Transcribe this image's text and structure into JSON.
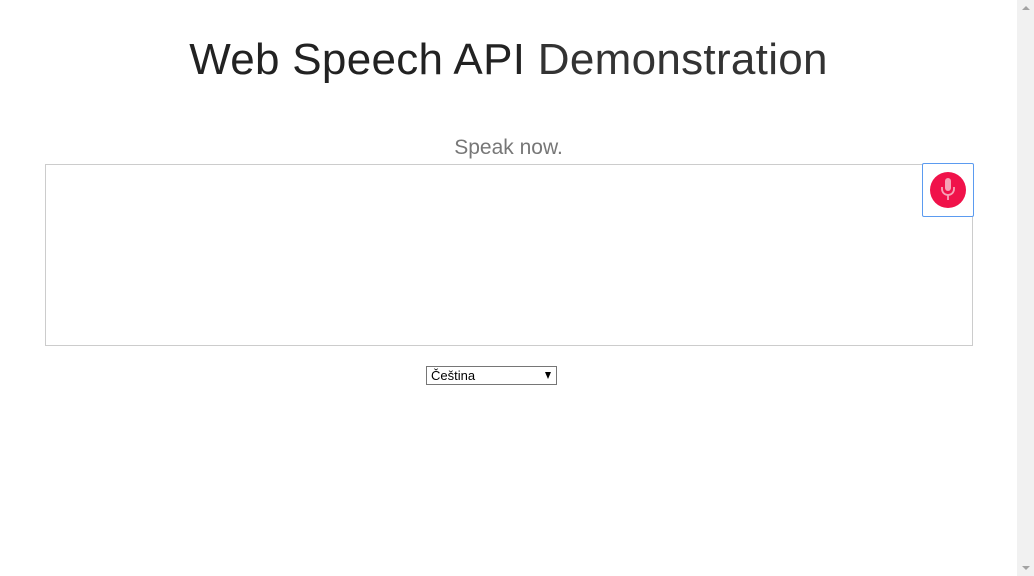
{
  "header": {
    "title_part1": "Web Speech API",
    "title_part2": "Demonstration"
  },
  "status": {
    "info_text": "Speak now."
  },
  "results": {
    "final_text": "",
    "interim_text": ""
  },
  "mic": {
    "icon": "microphone-icon",
    "color": "#f0124a"
  },
  "language": {
    "selected": "Čeština"
  }
}
